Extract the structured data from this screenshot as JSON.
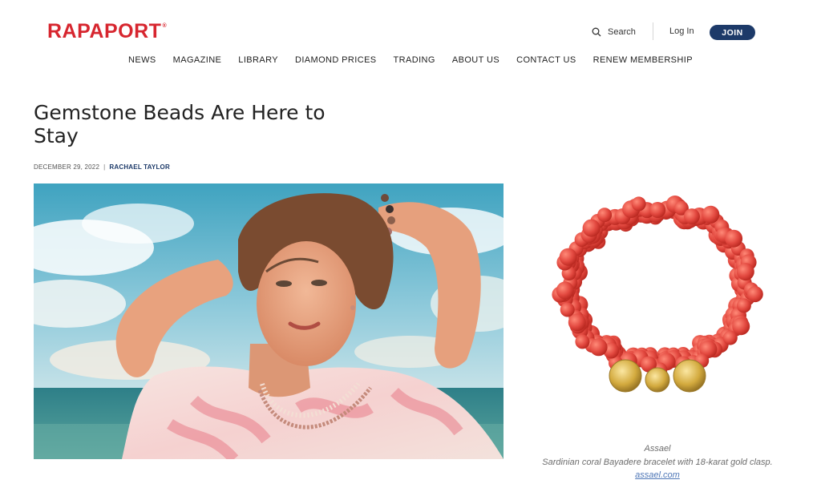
{
  "brand": {
    "logo_text": "RAPAPORT",
    "registered": "®"
  },
  "header": {
    "search_label": "Search",
    "login_label": "Log In",
    "join_label": "JOIN"
  },
  "nav": {
    "items": [
      "NEWS",
      "MAGAZINE",
      "LIBRARY",
      "DIAMOND PRICES",
      "TRADING",
      "ABOUT US",
      "CONTACT US",
      "RENEW MEMBERSHIP"
    ]
  },
  "article": {
    "title": "Gemstone Beads Are Here to Stay",
    "date": "DECEMBER 29, 2022",
    "separator": "|",
    "author": "RACHAEL TAYLOR"
  },
  "caption": {
    "brand": "Assael",
    "description": "Sardinian coral Bayadere bracelet with 18-karat gold clasp.",
    "link": "assael.com"
  },
  "colors": {
    "brand_red": "#d7262f",
    "navy": "#1d3a69",
    "coral": "#e2483f",
    "gold": "#d3aa3e"
  },
  "icons": {
    "search": "search-icon"
  }
}
